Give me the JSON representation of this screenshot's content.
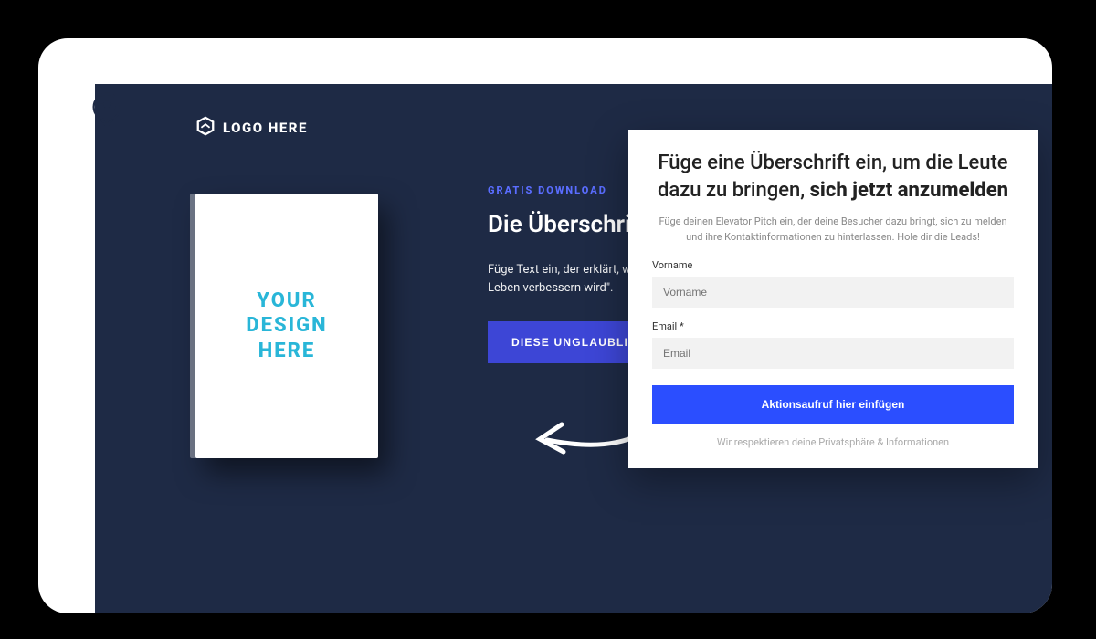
{
  "logo": {
    "text": "LOGO HERE"
  },
  "book": {
    "label": "YOUR\nDESIGN\nHERE"
  },
  "hero": {
    "eyebrow": "GRATIS DOWNLOAD",
    "headline": "Die Überschrift herunterladen",
    "description": "Füge Text ein, der erklärt, warum sie es wirklich wollen. Leben verbessern wird\".",
    "cta": "DIESE UNGLAUBLICHE"
  },
  "popup": {
    "title_part1": "Füge eine Überschrift ein, um die Leute dazu zu bringen, ",
    "title_bold": "sich jetzt anzumelden",
    "subtitle": "Füge deinen Elevator Pitch ein, der deine Besucher dazu bringt, sich zu melden und ihre Kontaktinformationen zu hinterlassen. Hole dir die Leads!",
    "fields": {
      "firstname": {
        "label": "Vorname",
        "placeholder": "Vorname"
      },
      "email": {
        "label": "Email *",
        "placeholder": "Email"
      }
    },
    "cta": "Aktionsaufruf hier einfügen",
    "privacy": "Wir respektieren deine Privatsphäre & Informationen"
  }
}
